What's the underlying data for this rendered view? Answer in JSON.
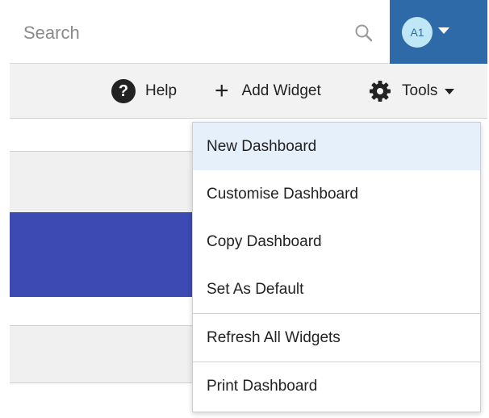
{
  "search": {
    "placeholder": "Search"
  },
  "user": {
    "initials": "A1"
  },
  "toolbar": {
    "help_label": "Help",
    "add_widget_label": "Add Widget",
    "tools_label": "Tools",
    "help_icon_glyph": "?"
  },
  "menu": {
    "items": [
      {
        "label": "New Dashboard"
      },
      {
        "label": "Customise Dashboard"
      },
      {
        "label": "Copy Dashboard"
      },
      {
        "label": "Set As Default"
      },
      {
        "label": "Refresh All Widgets"
      },
      {
        "label": "Print Dashboard"
      }
    ]
  },
  "colors": {
    "user_area": "#2f6aa8",
    "avatar_bg": "#bfe7f5",
    "accent_band": "#3d4ab4",
    "menu_highlight": "#e6f0fb"
  },
  "icons": [
    "search-icon",
    "help-icon",
    "plus-icon",
    "gear-icon",
    "caret-down-icon"
  ]
}
